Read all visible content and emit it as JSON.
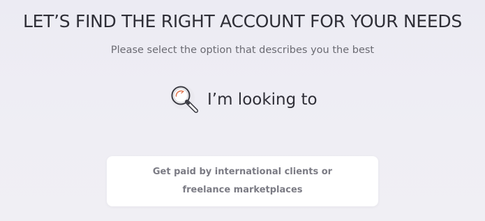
{
  "header": {
    "title": "LET’S FIND THE RIGHT ACCOUNT FOR YOUR NEEDS",
    "subtitle": "Please select the option that describes you the best"
  },
  "prompt": {
    "icon": "magnifier-icon",
    "text": "I’m looking to"
  },
  "options": [
    {
      "label": "Get paid by international clients or freelance marketplaces"
    }
  ],
  "colors": {
    "background": "#eeedf3",
    "title_text": "#2f2f37",
    "subtitle_text": "#6a6a72",
    "card_background": "#ffffff",
    "card_text": "#7b7b84",
    "icon_accent": "#e07a55"
  }
}
